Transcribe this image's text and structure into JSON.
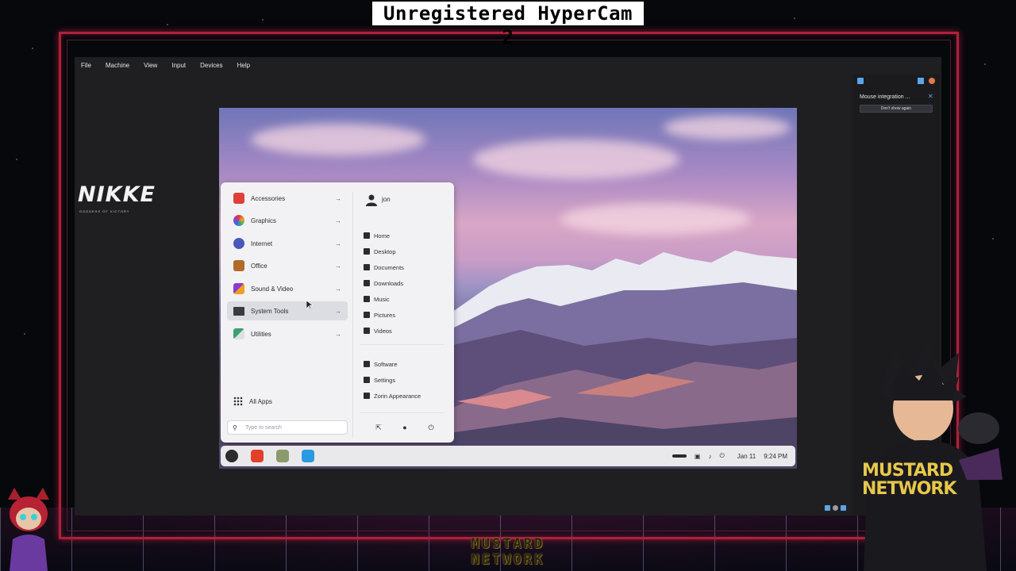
{
  "overlay": {
    "hypercam_label": "Unregistered HyperCam 2",
    "left_logo": "NIKKE",
    "left_logo_sub": "GODDESS OF VICTORY",
    "bottom_logo_line1": "MUSTARD",
    "bottom_logo_line2": "NETWORK",
    "mascot_text": "MUSTARD NETWORK"
  },
  "vbox": {
    "menu": [
      "File",
      "Machine",
      "View",
      "Input",
      "Devices",
      "Help"
    ],
    "notice": {
      "title": "Mouse integration ...",
      "close_glyph": "✕",
      "dont_show_label": "Don't show again"
    }
  },
  "startmenu": {
    "categories": [
      {
        "label": "Accessories",
        "icon": "toolbox-icon",
        "color": "#e0403a"
      },
      {
        "label": "Graphics",
        "icon": "palette-icon",
        "color": "#f0a020"
      },
      {
        "label": "Internet",
        "icon": "globe-icon",
        "color": "#4a5ab8"
      },
      {
        "label": "Office",
        "icon": "briefcase-icon",
        "color": "#b06a2a"
      },
      {
        "label": "Sound & Video",
        "icon": "media-icon",
        "color": "#8a3ad0"
      },
      {
        "label": "System Tools",
        "icon": "monitor-icon",
        "color": "#3a3a40"
      },
      {
        "label": "Utilities",
        "icon": "utilities-icon",
        "color": "#3aa070"
      }
    ],
    "arrow_glyph": "→",
    "all_apps_label": "All Apps",
    "search_placeholder": "Type to search",
    "user": "jon",
    "places": [
      "Home",
      "Desktop",
      "Documents",
      "Downloads",
      "Music",
      "Pictures",
      "Videos"
    ],
    "system": [
      "Software",
      "Settings",
      "Zorin Appearance"
    ]
  },
  "taskbar": {
    "date": "Jan 11",
    "time": "9:24 PM"
  }
}
